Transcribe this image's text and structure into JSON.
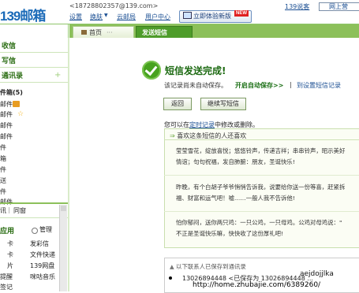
{
  "header": {
    "logo": "139邮箱",
    "email": "<18728802357@139.com>",
    "links": [
      "设置",
      "换肤",
      "云邮局",
      "用户中心"
    ],
    "skin_arrow": "▼",
    "upgrade_button": "立即体验新版",
    "new_badge": "NEW",
    "right_link_139": "139说客",
    "right_link_mall": "网上营"
  },
  "tabs": {
    "home": "首页",
    "home_dots": "···",
    "send_sms": "发送短信"
  },
  "sidebar": {
    "receive": "收信",
    "write": "写信",
    "contacts": "通讯录",
    "plus": "+",
    "folder_title": "件箱(5)",
    "folders": [
      "邮件",
      "邮件",
      "邮件",
      "邮件",
      "件",
      "箱",
      "件",
      "送",
      "件",
      "邮件"
    ],
    "im_left": "讯",
    "im_sep": "|",
    "im_right": "同窗",
    "apps_title": "应用",
    "manage": "管理",
    "apps": [
      [
        "卡",
        "发彩信"
      ],
      [
        "卡",
        "文件快递"
      ],
      [
        "片",
        "139网盘"
      ],
      [
        "提醒",
        "咪咕音乐"
      ],
      [
        "签记",
        ""
      ]
    ]
  },
  "main": {
    "success_title": "短信发送完成!",
    "notice": "该记录尚未自动保存。",
    "auto_save": "开启自动保存>>",
    "arrows": "|",
    "go_settings": "到设置短信记录",
    "back_button": "返回",
    "continue_button": "继续写短信",
    "modify_note_pre": "您可以在",
    "modify_note_link": "定时记录",
    "modify_note_post": "中修改或删除。",
    "recommend_title": "喜欢这条短信的人还喜欢",
    "messages": [
      "莹莹雪花，绽放喜悦；悠悠铃声，传递吉祥；串串铃声，昭示美好",
      "情谊；句句祝福，发自肺腑：朋友，圣诞快乐!",
      "昨晚，有个白胡子爷爷悄悄告诉我，说要给你送一份等喜，赶紧拆",
      "福、财富和运气吧！嘘……一般人我不告诉他!",
      "怕你郁闷，送你两只鸡：一只公鸡，一只母鸡。公鸡对母鸡说：\"",
      "不正是圣诞快乐嘛，快快收了这份厚礼吧!"
    ],
    "saved_title": "以下联系人已保存到通讯录",
    "saved_number": "13026894448",
    "saved_text": "<已保存为 13026894448 ...",
    "watermark": "aejdojjlka",
    "url": "http://home.zhubajie.com/6389260/"
  },
  "colors": {
    "accent_green": "#4e9c2a",
    "tab_strip": "#8cc05a",
    "link_blue": "#1b4f93",
    "new_red": "#e02020"
  },
  "icons": [
    "check-circle-icon",
    "home-icon",
    "monitor-icon",
    "inbox-icon",
    "star-icon",
    "gear-icon"
  ]
}
